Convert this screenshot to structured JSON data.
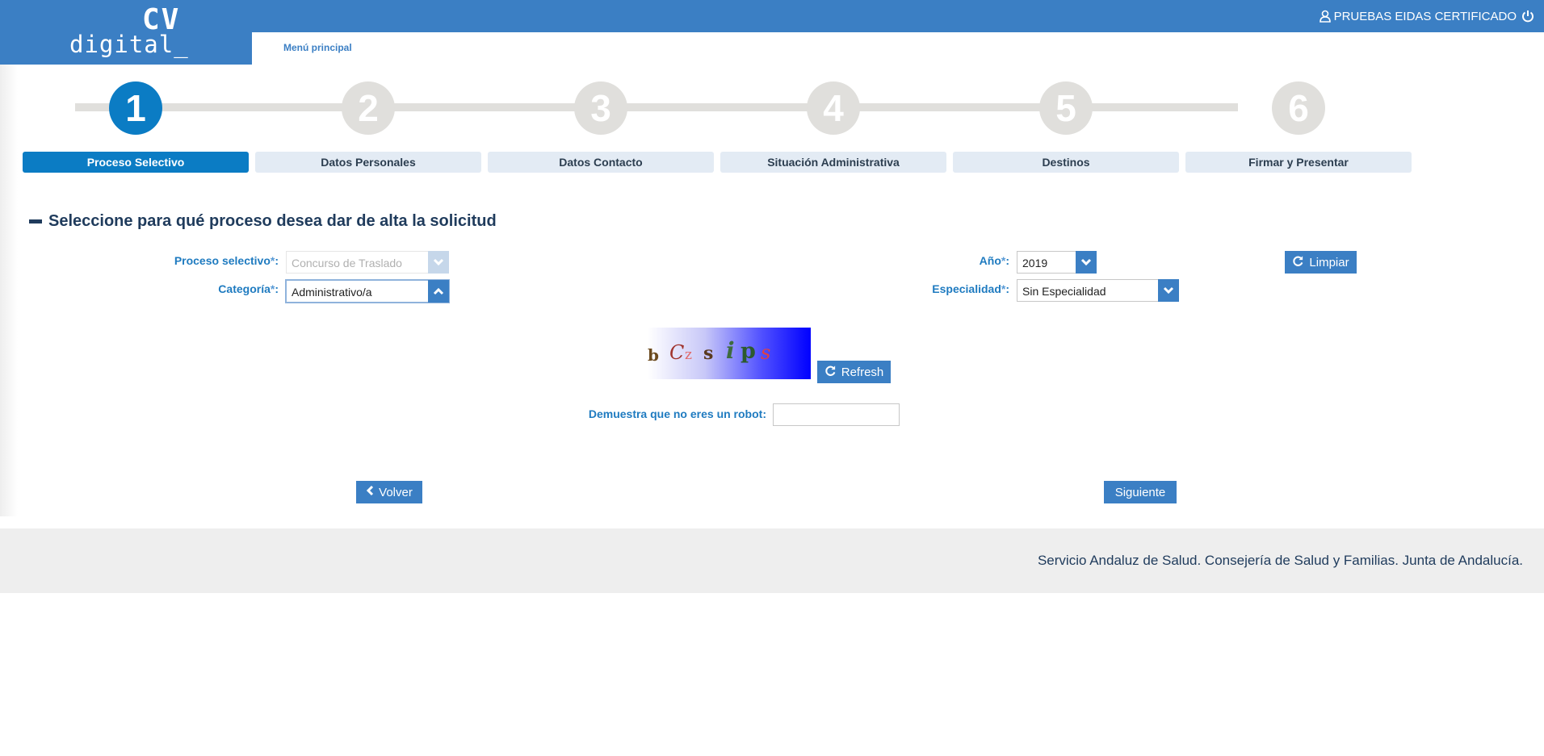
{
  "header": {
    "logo_top": "CV",
    "logo_bottom": "digital_",
    "user_name": "PRUEBAS EIDAS CERTIFICADO",
    "menu_link": "Menú principal",
    "brand_color": "#3b7fc4"
  },
  "stepper": {
    "active_step": 1,
    "steps": [
      {
        "number": "1",
        "label": "Proceso Selectivo"
      },
      {
        "number": "2",
        "label": "Datos Personales"
      },
      {
        "number": "3",
        "label": "Datos Contacto"
      },
      {
        "number": "4",
        "label": "Situación Administrativa"
      },
      {
        "number": "5",
        "label": "Destinos"
      },
      {
        "number": "6",
        "label": "Firmar y Presentar"
      }
    ]
  },
  "section": {
    "title": "Seleccione para qué proceso desea dar de alta la solicitud"
  },
  "form": {
    "proceso_label": "Proceso selectivo",
    "proceso_value": "Concurso de Traslado",
    "categoria_label": "Categoría",
    "categoria_value": "Administrativo/a",
    "anio_label": "Año",
    "anio_value": "2019",
    "especialidad_label": "Especialidad",
    "especialidad_value": "Sin Especialidad",
    "required_mark": "*",
    "colon": ":",
    "limpiar_label": "Limpiar"
  },
  "captcha": {
    "chars": [
      "b",
      "C",
      "z",
      "s",
      "i",
      "p",
      "s"
    ],
    "refresh_label": "Refresh",
    "robot_label": "Demuestra que no eres un robot:",
    "robot_value": ""
  },
  "nav": {
    "back_label": "Volver",
    "next_label": "Siguiente"
  },
  "footer": {
    "text": "Servicio Andaluz de Salud. Consejería de Salud y Familias. Junta de Andalucía."
  }
}
